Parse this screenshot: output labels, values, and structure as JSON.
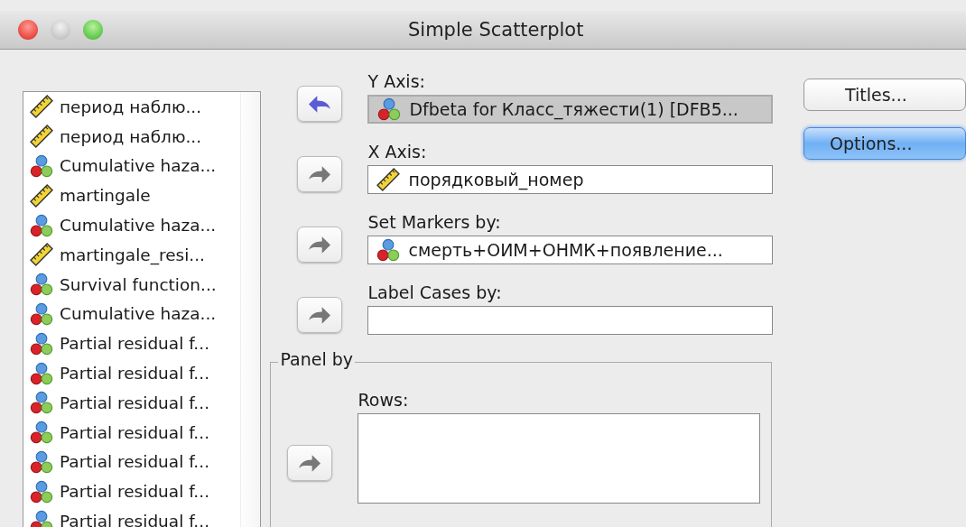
{
  "window": {
    "title": "Simple Scatterplot"
  },
  "variables": [
    {
      "kind": "scale",
      "label": "период наблю..."
    },
    {
      "kind": "scale",
      "label": "период наблю..."
    },
    {
      "kind": "nominal",
      "label": "Cumulative haza..."
    },
    {
      "kind": "scale",
      "label": "martingale"
    },
    {
      "kind": "nominal",
      "label": "Cumulative haza..."
    },
    {
      "kind": "scale",
      "label": "martingale_resi..."
    },
    {
      "kind": "nominal",
      "label": "Survival function..."
    },
    {
      "kind": "nominal",
      "label": "Cumulative haza..."
    },
    {
      "kind": "nominal",
      "label": "Partial residual f..."
    },
    {
      "kind": "nominal",
      "label": "Partial residual f..."
    },
    {
      "kind": "nominal",
      "label": "Partial residual f..."
    },
    {
      "kind": "nominal",
      "label": "Partial residual f..."
    },
    {
      "kind": "nominal",
      "label": "Partial residual f..."
    },
    {
      "kind": "nominal",
      "label": "Partial residual f..."
    },
    {
      "kind": "nominal",
      "label": "Partial residual f..."
    }
  ],
  "targets": [
    {
      "label": "Y Axis:",
      "arrow_left": true,
      "selected": true,
      "value": {
        "kind": "nominal",
        "text": "Dfbeta for Класс_тяжести(1) [DFB5..."
      }
    },
    {
      "label": "X Axis:",
      "arrow_left": false,
      "selected": false,
      "value": {
        "kind": "scale",
        "text": "порядковый_номер"
      }
    },
    {
      "label": "Set Markers by:",
      "arrow_left": false,
      "selected": false,
      "value": {
        "kind": "nominal",
        "text": "смерть+ОИМ+ОНМК+появление..."
      }
    },
    {
      "label": "Label Cases by:",
      "arrow_left": false,
      "selected": false
    }
  ],
  "panel": {
    "title": "Panel by",
    "rows": {
      "label": "Rows:",
      "arrow_left": false
    }
  },
  "buttons": [
    {
      "label": "Titles...",
      "default": false
    },
    {
      "label": "Options...",
      "default": true
    }
  ]
}
